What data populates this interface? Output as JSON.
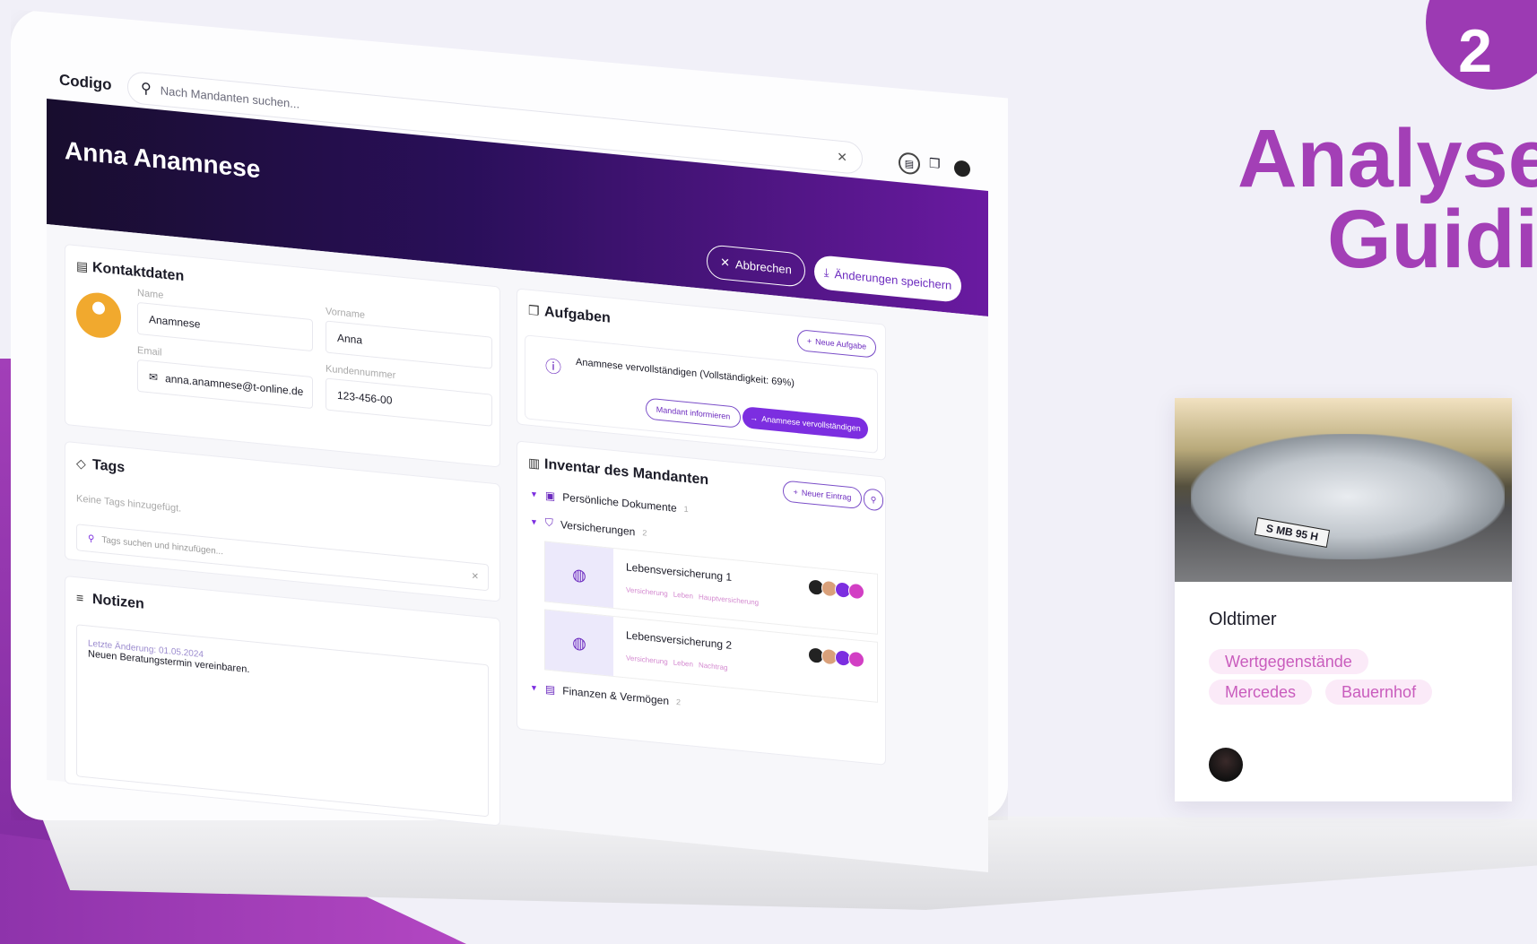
{
  "app": {
    "logo": "Codigo",
    "search_placeholder": "Nach Mandanten suchen..."
  },
  "header": {
    "client_name": "Anna Anamnese",
    "cancel_label": "Abbrechen",
    "save_label": "Änderungen speichern"
  },
  "kontakt": {
    "title": "Kontaktdaten",
    "name_label": "Name",
    "name_value": "Anamnese",
    "vorname_label": "Vorname",
    "vorname_value": "Anna",
    "email_label": "Email",
    "email_value": "anna.anamnese@t-online.de",
    "kunden_label": "Kundennummer",
    "kunden_value": "123-456-00"
  },
  "tags": {
    "title": "Tags",
    "empty_text": "Keine Tags hinzugefügt.",
    "search_placeholder": "Tags suchen und hinzufügen..."
  },
  "notizen": {
    "title": "Notizen",
    "last_change": "Letzte Änderung: 01.05.2024",
    "text": "Neuen Beratungstermin vereinbaren."
  },
  "aufgaben": {
    "title": "Aufgaben",
    "new_label": "Neue Aufgabe",
    "task_text": "Anamnese vervollständigen (Vollständigkeit: 69%)",
    "inform_label": "Mandant informieren",
    "complete_label": "Anamnese vervollständigen"
  },
  "inventar": {
    "title": "Inventar des Mandanten",
    "new_label": "Neuer Eintrag",
    "groups": [
      {
        "label": "Persönliche Dokumente",
        "count": "1"
      },
      {
        "label": "Versicherungen",
        "count": "2"
      },
      {
        "label": "Finanzen & Vermögen",
        "count": "2"
      }
    ],
    "items": [
      {
        "name": "Lebensversicherung 1",
        "tags": [
          "Versicherung",
          "Leben",
          "Hauptversicherung"
        ]
      },
      {
        "name": "Lebensversicherung 2",
        "tags": [
          "Versicherung",
          "Leben",
          "Nachtrag"
        ]
      }
    ]
  },
  "right": {
    "step_number": "2",
    "headline_line1": "Analyse",
    "headline_line2": "Guidi",
    "card_title": "Oldtimer",
    "card_tags": [
      "Wertgegenstände",
      "Mercedes",
      "Bauernhof"
    ],
    "plate_text": "S MB 95 H"
  },
  "colors": {
    "accent": "#7c2ee0",
    "brand_purple": "#a33fb6",
    "header_dark": "#180d2e"
  }
}
